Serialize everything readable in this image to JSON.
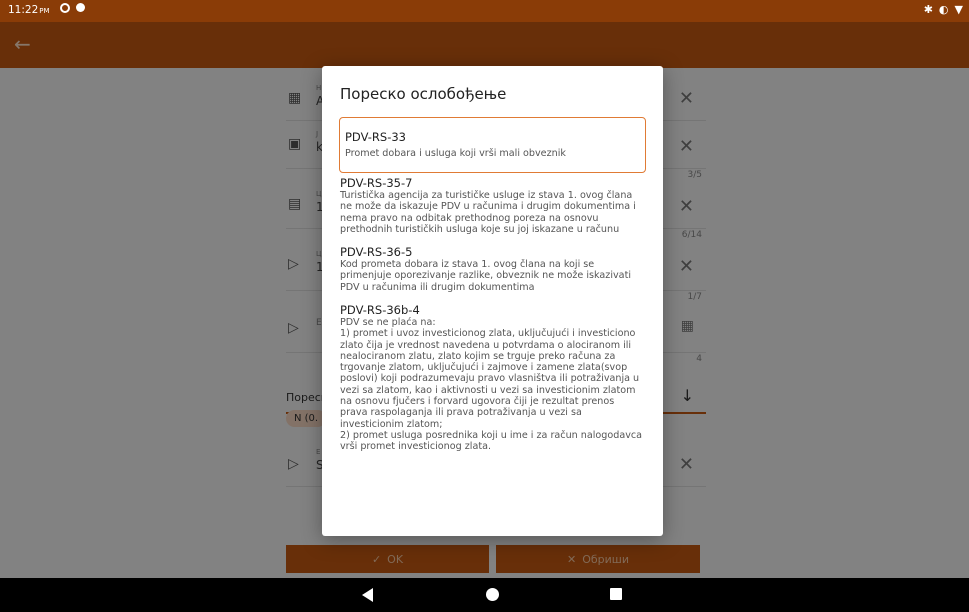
{
  "status_bar": {
    "time": "11:22",
    "ampm": "PM",
    "icons_left": [
      "circle-status-icon",
      "dot-status-icon"
    ],
    "icons_right": [
      "bluetooth-icon",
      "vibrate-icon",
      "wifi-icon"
    ]
  },
  "background": {
    "rows": [
      {
        "label": "H",
        "value": "A",
        "icon": "barcode-icon"
      },
      {
        "label": "J",
        "value": "k",
        "icon": "box-icon",
        "count": "3/5"
      },
      {
        "label": "Ц",
        "value": "1",
        "icon": "money-icon",
        "count": "6/14"
      },
      {
        "label": "Ц",
        "value": "1",
        "icon": "tag-icon",
        "count": "1/7"
      },
      {
        "label": "E",
        "value": "",
        "icon": "tag-icon",
        "count": "4"
      }
    ],
    "tab_label": "Пореск",
    "chip_label": "N (0.",
    "last_row": {
      "label": "E",
      "value": "S"
    },
    "ok_button": "OK",
    "clear_button": "Обриши"
  },
  "dialog": {
    "title": "Пореско ослобођење",
    "options": [
      {
        "code": "PDV-RS-33",
        "description": "Promet dobara i usluga koji vrši mali obveznik",
        "selected": true
      },
      {
        "code": "PDV-RS-35-7",
        "description": "Turistička agencija za turističke usluge iz stava 1. ovog člana ne može da iskazuje PDV u računima i drugim dokumentima i nema pravo na odbitak prethodnog poreza na osnovu prethodnih turističkih usluga koje su joj iskazane u računu",
        "selected": false
      },
      {
        "code": "PDV-RS-36-5",
        "description": "Kod prometa dobara iz stava 1. ovog člana na koji se primenjuje oporezivanje razlike, obveznik ne može iskazivati PDV u računima ili drugim dokumentima",
        "selected": false
      },
      {
        "code": "PDV-RS-36b-4",
        "description": "PDV se ne plaća na:\n1) promet i uvoz investicionog zlata, uključujući i investiciono zlato čija je vrednost navedena u potvrdama o alociranom ili nealociranom zlatu, zlato kojim se trguje preko računa za trgovanje zlatom, uključujući i zajmove i zamene zlata(svop poslovi) koji podrazumevaju pravo vlasništva ili potraživanja u vezi sa zlatom, kao i aktivnosti u vezi sa investicionim zlatom na osnovu fjučers i forvard ugovora čiji je rezultat prenos prava raspolaganja ili prava potraživanja u vezi sa investicionim zlatom;\n2) promet usluga posrednika koji u ime i za račun nalogodavca vrši promet investicionog zlata.",
        "selected": false
      }
    ]
  },
  "nav": {
    "icons": [
      "back-triangle-icon",
      "home-circle-icon",
      "recents-square-icon"
    ]
  },
  "colors": {
    "primary": "#c55a11",
    "statusbar": "#8a3c07",
    "selected_border": "#e07b35"
  }
}
